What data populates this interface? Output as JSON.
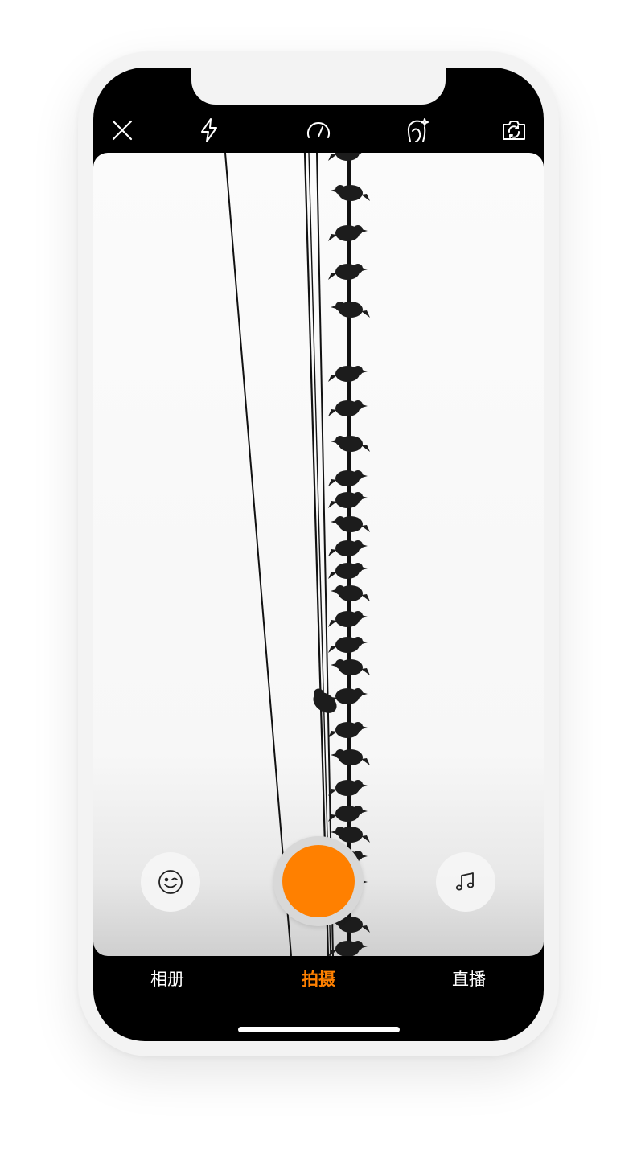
{
  "top_bar": {
    "icons": [
      "close-icon",
      "flash-icon",
      "speed-icon",
      "beauty-icon",
      "flip-camera-icon"
    ]
  },
  "controls": {
    "left_button_icon": "emoji-face-icon",
    "shutter_color": "#ff8000",
    "right_button_icon": "music-note-icon"
  },
  "modes": {
    "album": "相册",
    "shoot": "拍摄",
    "live": "直播",
    "active": "shoot"
  },
  "colors": {
    "accent": "#ff8000",
    "bar_background": "#000000",
    "text": "#ffffff"
  }
}
